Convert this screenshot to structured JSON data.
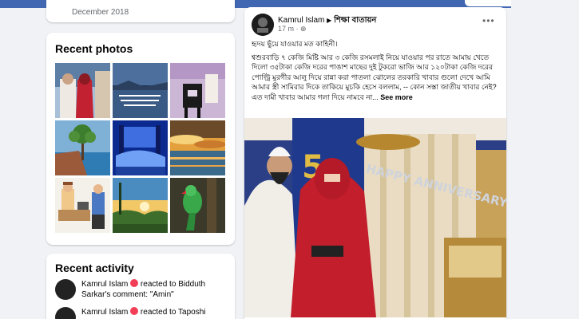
{
  "left_column": {
    "top_card": {
      "date_text": "December 2018"
    },
    "recent_photos": {
      "title": "Recent photos",
      "photos": [
        {
          "icon": "couple-photo"
        },
        {
          "icon": "lake-quote-photo"
        },
        {
          "icon": "furniture-photo"
        },
        {
          "icon": "tree-photo"
        },
        {
          "icon": "blue-bed-photo"
        },
        {
          "icon": "sunset-clouds-photo"
        },
        {
          "icon": "cartoon-office-photo"
        },
        {
          "icon": "sunset-valley-photo"
        },
        {
          "icon": "parrot-photo"
        }
      ]
    },
    "recent_activity": {
      "title": "Recent activity",
      "items": [
        {
          "name": "Kamrul Islam",
          "action": "reacted to",
          "target": "Bidduth Sarkar",
          "rest": "'s comment: \"Amin\""
        },
        {
          "name": "Kamrul Islam",
          "action": "reacted to",
          "target": "Taposhi",
          "rest": ""
        }
      ]
    }
  },
  "post": {
    "author": "Kamrul Islam",
    "group": "শিক্ষা বাতায়ন",
    "time": "17 m",
    "more_label": "•••",
    "text_intro": "হৃদয় ছুঁয়ে যাওয়ার মত কাহিনী।",
    "text_body": "শ্বশুরবাড়ি ৭ কেজি মিষ্টি আর ৩ কেজি রসমলাই নিয়ে যাওয়ার পর রাতে আমায় খেতে দিলো ৩৫টাকা কেজি দরের পাঙাশ মাছের দুই টুকরো ভাজি আর ১২০টাকা কেজি দরের পোল্ট্রি মুরগীর আলু দিয়ে রান্না করা পাতলা ঝোলের তরকারি",
    "text_body2": "খাবার গুলো দেখে আমি আমার স্ত্রী সামিরার দিকে তাকিয়ে মুচকি হেসে বললাম,",
    "text_body3": "-- কোন সস্তা জাতীয় খাবার নেই? এত দামী খাবার আমার গলা দিয়ে নামবে না...",
    "see_more": "See more",
    "image_banner": "HAPPY ANNIVERSARY",
    "image_number": "5"
  },
  "colors": {
    "topbar": "#4267b2",
    "background": "#f0f2f5",
    "heart": "#f33e58",
    "secondary_text": "#65676b"
  }
}
